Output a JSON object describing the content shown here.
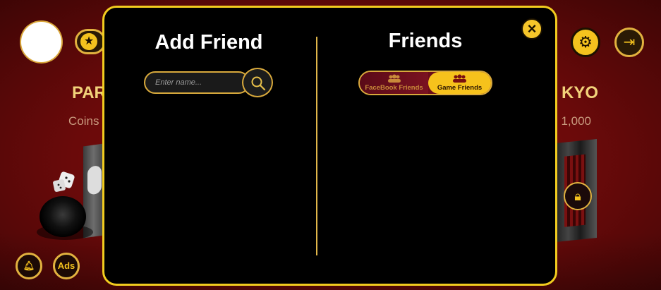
{
  "background": {
    "left_title": "PAR",
    "left_sub": "Coins",
    "right_title": "KYO",
    "right_sub": ": 1,000",
    "ads_label": "Ads"
  },
  "modal": {
    "add_friend_title": "Add Friend",
    "search_placeholder": "Enter name...",
    "friends_title": "Friends",
    "tabs": [
      {
        "label": "FaceBook Friends",
        "active": false
      },
      {
        "label": "Game Friends",
        "active": true
      }
    ]
  },
  "colors": {
    "accent": "#f2cc1f",
    "background": "#7a0c0c",
    "modal_bg": "#000000"
  },
  "icons": [
    "star-icon",
    "gear-icon",
    "exit-icon",
    "lock-icon",
    "bell-icon",
    "close-icon",
    "search-icon",
    "people-icon"
  ]
}
